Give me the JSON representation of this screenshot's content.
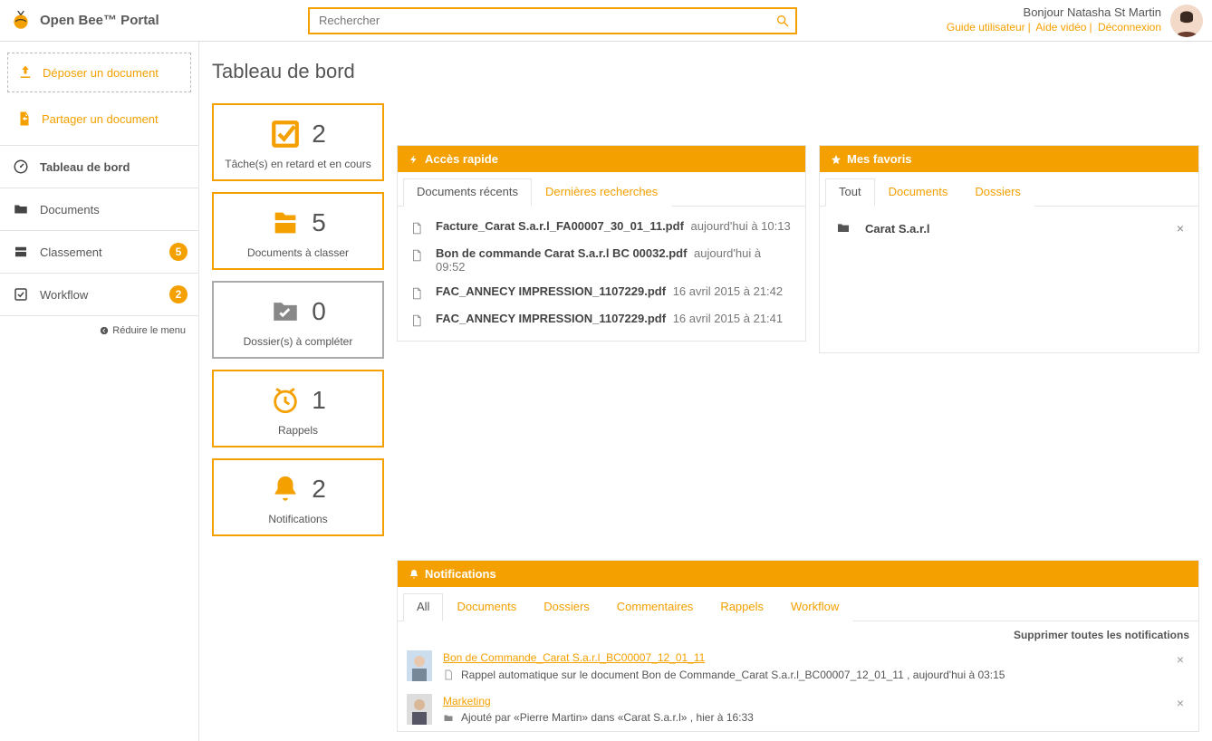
{
  "app": {
    "title": "Open Bee™ Portal"
  },
  "search": {
    "placeholder": "Rechercher"
  },
  "user": {
    "greeting": "Bonjour Natasha St Martin",
    "links": {
      "guide": "Guide utilisateur",
      "video": "Aide vidéo",
      "logout": "Déconnexion"
    }
  },
  "sidebar": {
    "upload": "Déposer un document",
    "share": "Partager un document",
    "items": [
      {
        "label": "Tableau de bord",
        "badge": null
      },
      {
        "label": "Documents",
        "badge": null
      },
      {
        "label": "Classement",
        "badge": "5"
      },
      {
        "label": "Workflow",
        "badge": "2"
      }
    ],
    "collapse": "Réduire le menu"
  },
  "page": {
    "title": "Tableau de bord"
  },
  "tiles": [
    {
      "num": "2",
      "label": "Tâche(s) en retard et en cours"
    },
    {
      "num": "5",
      "label": "Documents à classer"
    },
    {
      "num": "0",
      "label": "Dossier(s) à compléter"
    },
    {
      "num": "1",
      "label": "Rappels"
    },
    {
      "num": "2",
      "label": "Notifications"
    }
  ],
  "quick": {
    "title": "Accès rapide",
    "tabs": {
      "recent": "Documents récents",
      "searches": "Dernières recherches"
    },
    "rows": [
      {
        "name": "Facture_Carat S.a.r.l_FA00007_30_01_11.pdf",
        "date": "aujourd'hui à 10:13"
      },
      {
        "name": "Bon de commande Carat S.a.r.l BC 00032.pdf",
        "date": "aujourd'hui à 09:52"
      },
      {
        "name": "FAC_ANNECY IMPRESSION_1107229.pdf",
        "date": "16 avril 2015 à 21:42"
      },
      {
        "name": "FAC_ANNECY IMPRESSION_1107229.pdf",
        "date": "16 avril 2015 à 21:41"
      }
    ]
  },
  "favorites": {
    "title": "Mes favoris",
    "tabs": {
      "all": "Tout",
      "docs": "Documents",
      "folders": "Dossiers"
    },
    "rows": [
      {
        "name": "Carat S.a.r.l"
      }
    ]
  },
  "notifications": {
    "title": "Notifications",
    "tabs": {
      "all": "All",
      "docs": "Documents",
      "folders": "Dossiers",
      "comments": "Commentaires",
      "reminders": "Rappels",
      "workflow": "Workflow"
    },
    "clear_all": "Supprimer toutes les notifications",
    "rows": [
      {
        "title": "Bon de Commande_Carat S.a.r.l_BC00007_12_01_11",
        "text": "Rappel automatique sur le document Bon de Commande_Carat S.a.r.l_BC00007_12_01_11 , aujourd'hui à 03:15"
      },
      {
        "title": "Marketing",
        "text": "Ajouté par «Pierre Martin» dans «Carat S.a.r.l» , hier à 16:33"
      }
    ]
  }
}
